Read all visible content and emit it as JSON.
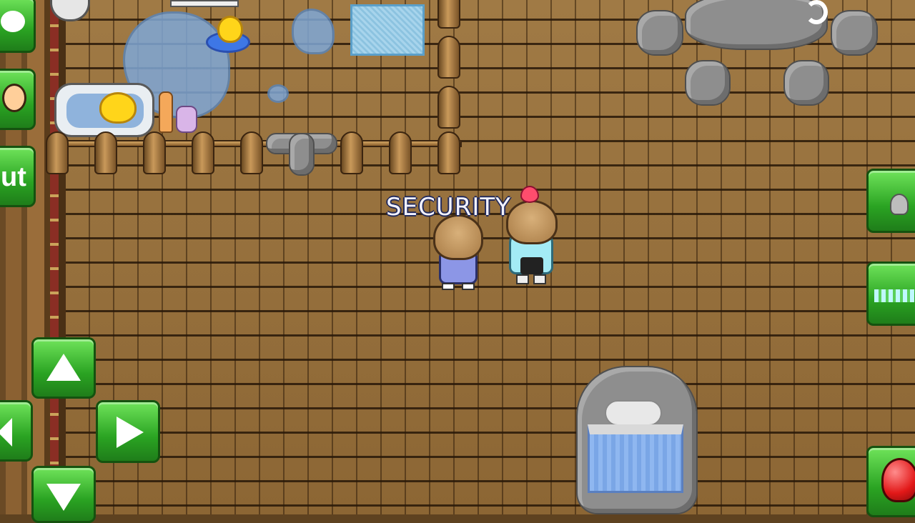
{
  "game": {
    "player_label": "SECURITY",
    "side_button_text": "ut"
  },
  "colors": {
    "floor": "#8c6634",
    "button_green": "#2aa322",
    "heart": "#ff4d6d",
    "water": "#7fa7d6"
  },
  "icons": {
    "move_up": "triangle-up",
    "move_left": "triangle-left",
    "move_right": "triangle-right",
    "move_down": "triangle-down",
    "punch": "boxing-glove",
    "emote": "smiley-face"
  }
}
